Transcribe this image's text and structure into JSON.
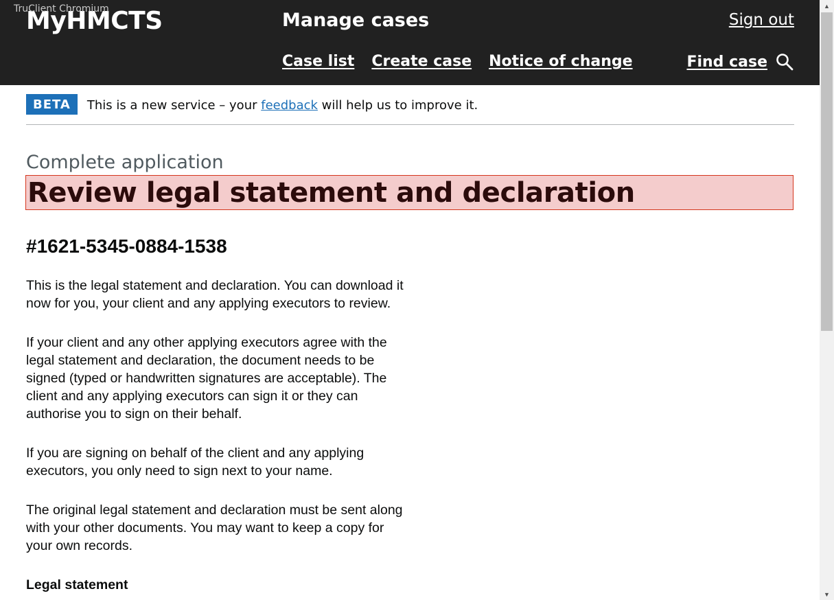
{
  "browser": {
    "watermark": "TruClient Chromium"
  },
  "header": {
    "brand": "MyHMCTS",
    "service_name": "Manage cases",
    "sign_out": "Sign out",
    "nav": [
      {
        "label": "Case list"
      },
      {
        "label": "Create case"
      },
      {
        "label": "Notice of change"
      }
    ],
    "find_case": "Find case",
    "find_case_icon": "search-icon"
  },
  "phase_banner": {
    "tag": "BETA",
    "text_before": "This is a new service – your ",
    "link": "feedback",
    "text_after": " will help us to improve it.",
    "tag_color": "#1d70b8"
  },
  "main": {
    "caption": "Complete application",
    "title": "Review legal statement and declaration",
    "title_highlight_color": "#f4cccc",
    "case_number": "#1621-5345-0884-1538",
    "paragraphs": [
      "This is the legal statement and declaration. You can download it now for you, your client and any applying executors to review.",
      "If your client and any other applying executors agree with the legal statement and declaration, the document needs to be signed (typed or handwritten signatures are acceptable). The client and any applying executors can sign it or they can authorise you to sign on their behalf.",
      "If you are signing on behalf of the client and any applying executors, you only need to sign next to your name.",
      "The original legal statement and declaration must be sent along with your other documents. You may want to keep a copy for your own records."
    ],
    "cut_off_heading": "Legal statement"
  },
  "scrollbar": {
    "up_icon": "arrow-up-icon",
    "down_icon": "arrow-down-icon"
  }
}
